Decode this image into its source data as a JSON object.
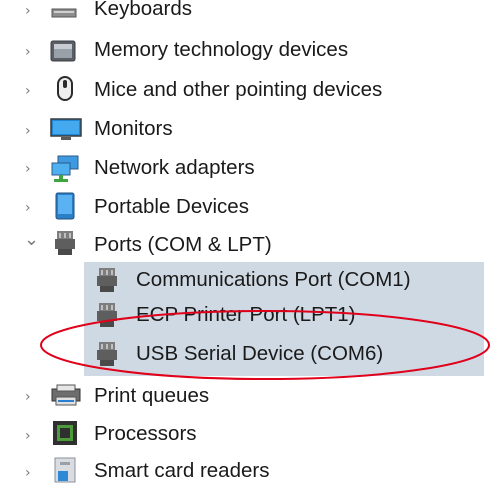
{
  "categories": [
    {
      "label": "Keyboards",
      "icon": "keyboard-icon",
      "expanded": false
    },
    {
      "label": "Memory technology devices",
      "icon": "memory-card-icon",
      "expanded": false
    },
    {
      "label": "Mice and other pointing devices",
      "icon": "mouse-icon",
      "expanded": false
    },
    {
      "label": "Monitors",
      "icon": "monitor-icon",
      "expanded": false
    },
    {
      "label": "Network adapters",
      "icon": "network-adapter-icon",
      "expanded": false
    },
    {
      "label": "Portable Devices",
      "icon": "portable-device-icon",
      "expanded": false
    },
    {
      "label": "Ports (COM & LPT)",
      "icon": "port-icon",
      "expanded": true
    },
    {
      "label": "Print queues",
      "icon": "printer-icon",
      "expanded": false
    },
    {
      "label": "Processors",
      "icon": "processor-icon",
      "expanded": false
    },
    {
      "label": "Smart card readers",
      "icon": "smart-card-reader-icon",
      "expanded": false
    }
  ],
  "ports": {
    "children": [
      {
        "label": "Communications Port (COM1)",
        "icon": "port-icon"
      },
      {
        "label": "ECP Printer Port (LPT1)",
        "icon": "port-icon"
      },
      {
        "label": "USB Serial Device (COM6)",
        "icon": "port-icon"
      }
    ]
  },
  "colors": {
    "selection": "#cfd9e3",
    "annotation_circle": "#e0001a",
    "text": "#1a1a1a"
  },
  "glyphs": {
    "collapsed": "›",
    "expanded": "⌄"
  }
}
